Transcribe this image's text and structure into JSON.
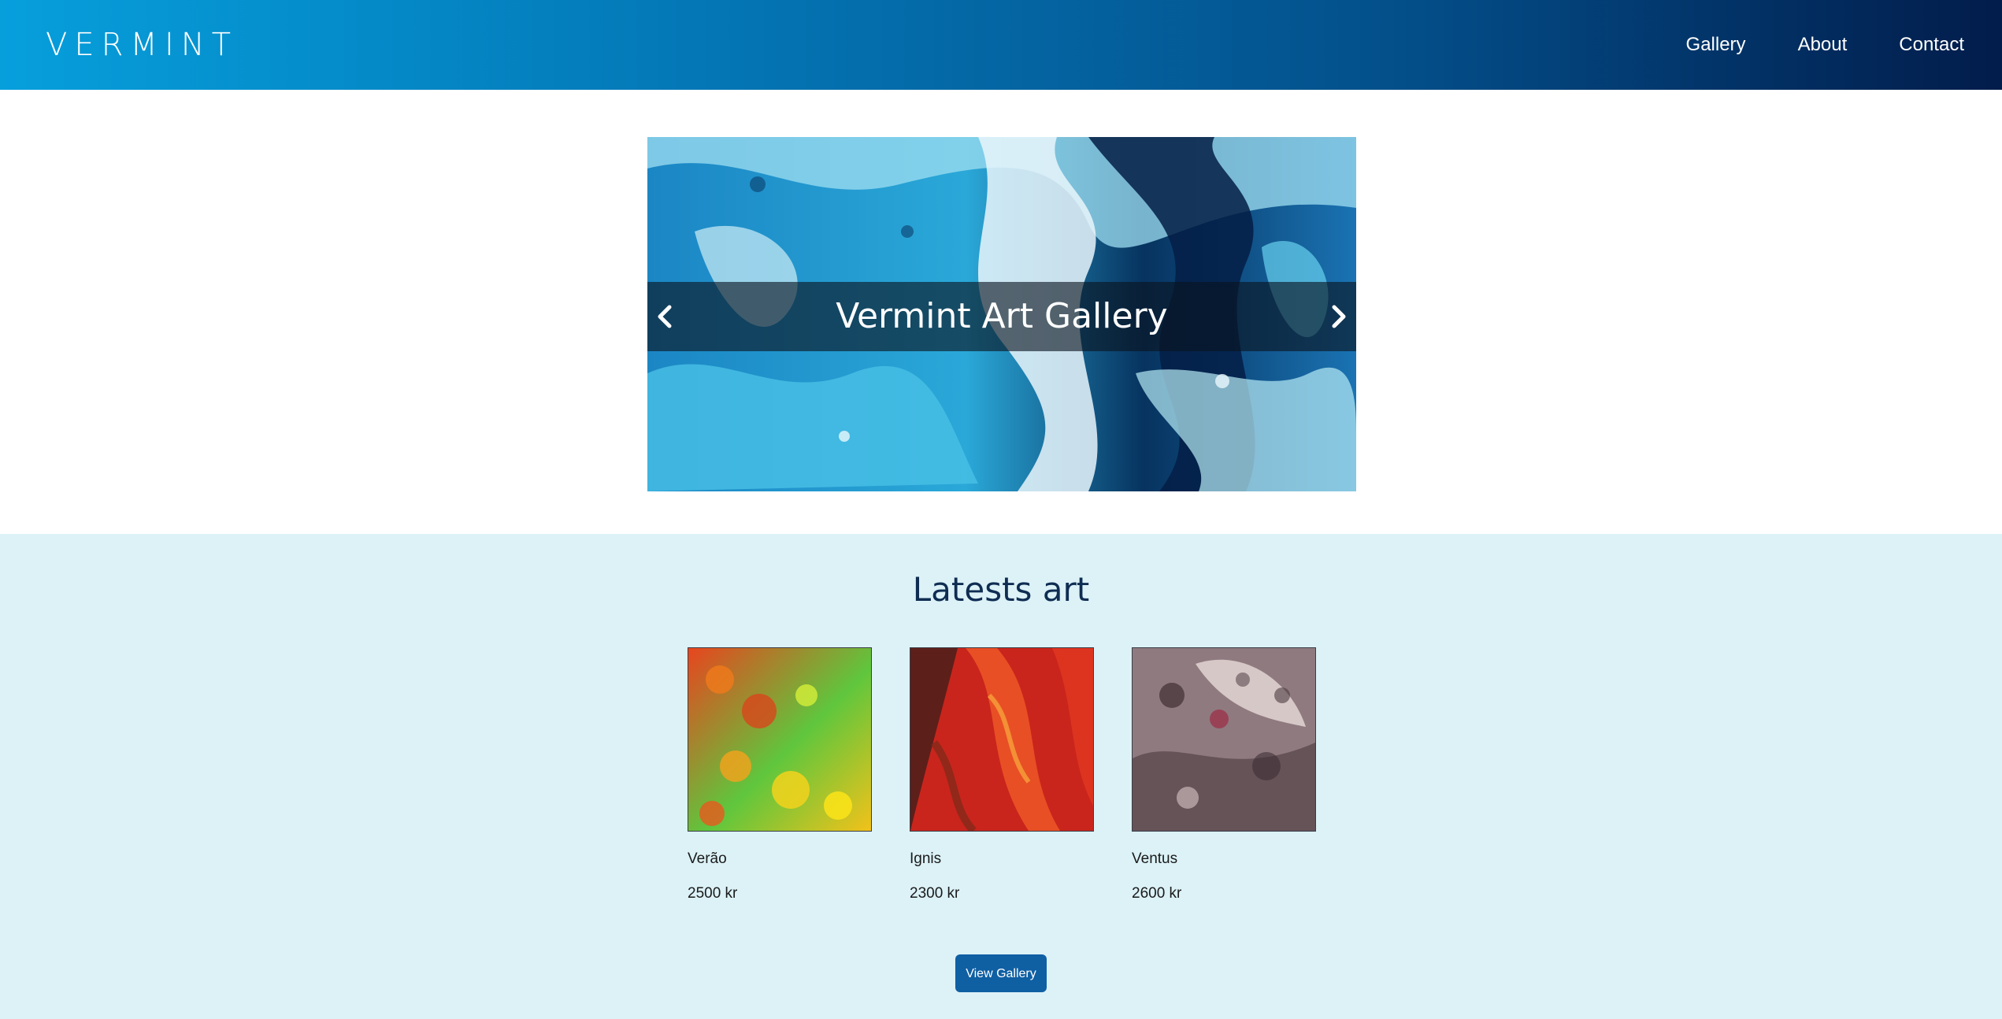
{
  "header": {
    "logo": "VERMINT",
    "nav": [
      {
        "label": "Gallery"
      },
      {
        "label": "About"
      },
      {
        "label": "Contact"
      }
    ]
  },
  "hero": {
    "caption": "Vermint Art Gallery",
    "prev_icon": "chevron-left-icon",
    "next_icon": "chevron-right-icon"
  },
  "latest": {
    "title": "Latests art",
    "items": [
      {
        "name": "Verão",
        "price": "2500 kr"
      },
      {
        "name": "Ignis",
        "price": "2300 kr"
      },
      {
        "name": "Ventus",
        "price": "2600 kr"
      }
    ],
    "button_label": "View Gallery"
  },
  "colors": {
    "header_start": "#069fdc",
    "header_end": "#021c4b",
    "section_bg": "#dcf2f7",
    "button_bg": "#0f5fa3",
    "title_color": "#0f2d52"
  }
}
